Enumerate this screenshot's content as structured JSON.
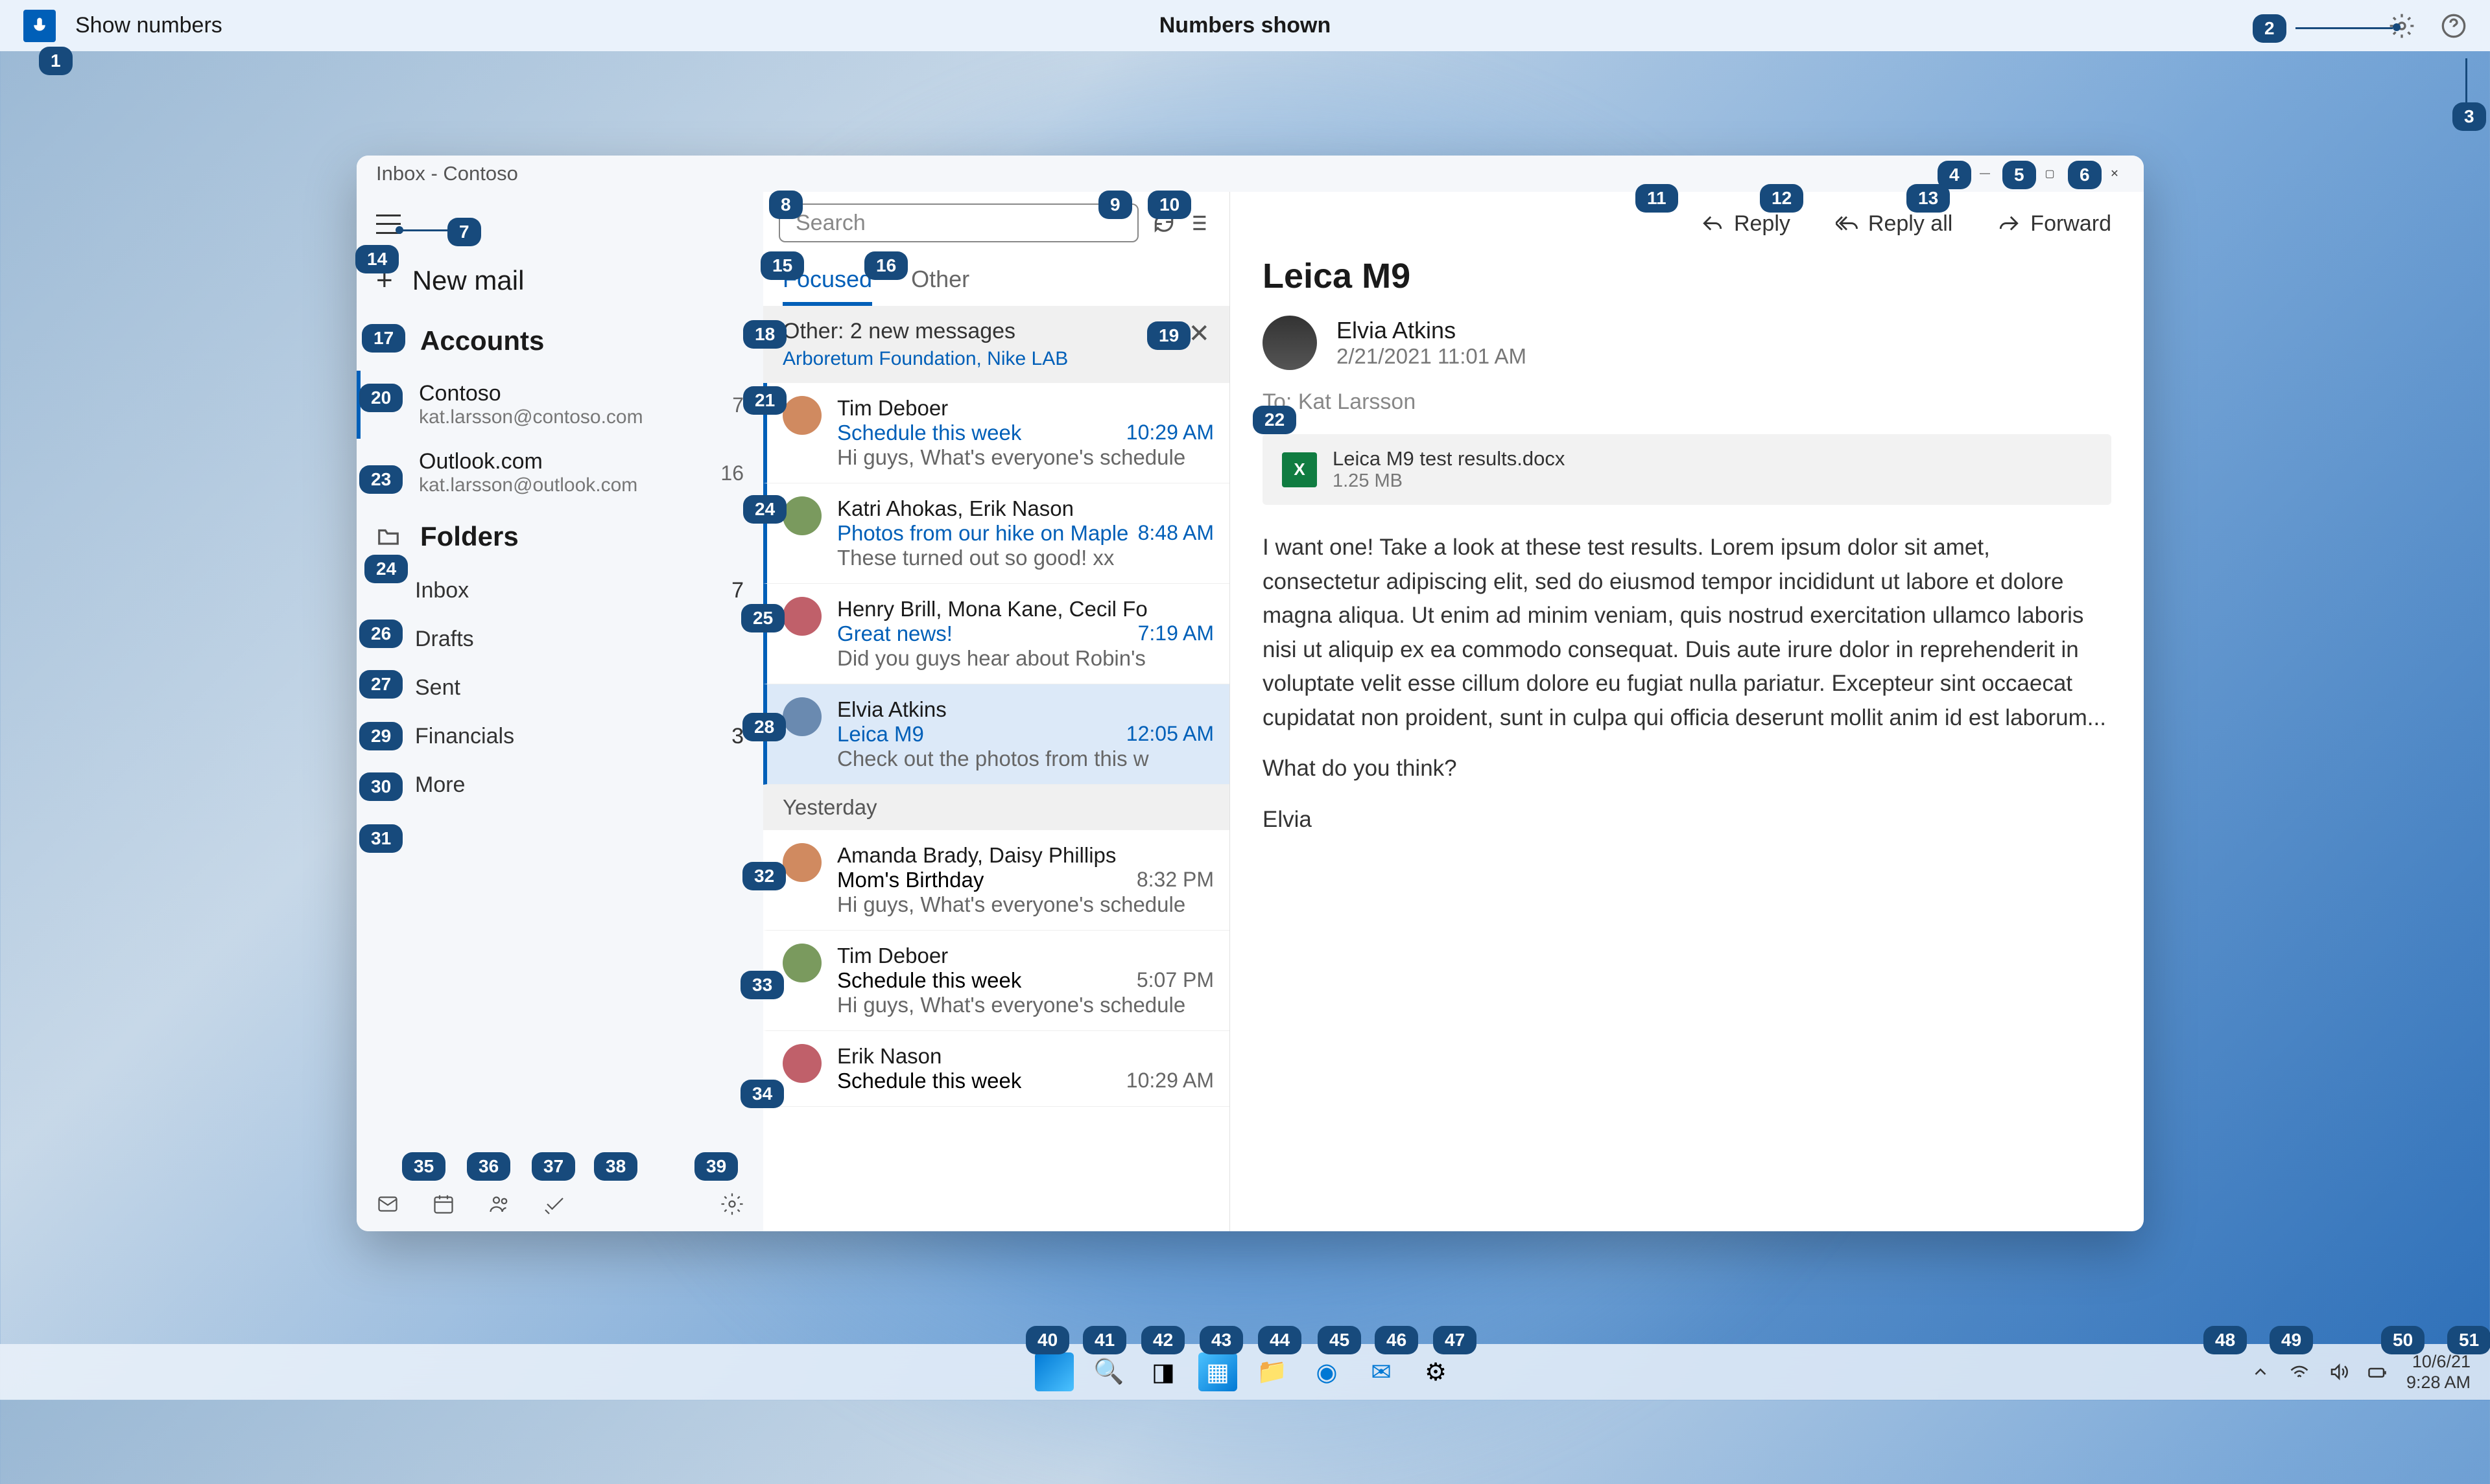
{
  "topbar": {
    "show_numbers": "Show numbers",
    "numbers_shown": "Numbers shown"
  },
  "window_title": "Inbox - Contoso",
  "nav": {
    "new_mail": "New mail",
    "accounts": "Accounts",
    "accounts_list": [
      {
        "name": "Contoso",
        "email": "kat.larsson@contoso.com",
        "count": "7"
      },
      {
        "name": "Outlook.com",
        "email": "kat.larsson@outlook.com",
        "count": "16"
      }
    ],
    "folders": "Folders",
    "folders_list": [
      {
        "name": "Inbox",
        "count": "7"
      },
      {
        "name": "Drafts",
        "count": ""
      },
      {
        "name": "Sent",
        "count": ""
      },
      {
        "name": "Financials",
        "count": "3"
      },
      {
        "name": "More",
        "count": ""
      }
    ]
  },
  "search_placeholder": "Search",
  "tabs": {
    "focused": "Focused",
    "other": "Other"
  },
  "other_banner": {
    "line1": "Other: 2 new messages",
    "line2": "Arboretum Foundation, Nike LAB"
  },
  "messages": [
    {
      "from": "Tim Deboer",
      "subject": "Schedule this week",
      "preview": "Hi guys, What's everyone's schedule",
      "time": "10:29 AM",
      "unread": true
    },
    {
      "from": "Katri Ahokas, Erik Nason",
      "subject": "Photos from our hike on Maple",
      "preview": "These turned out so good! xx",
      "time": "8:48 AM",
      "unread": true
    },
    {
      "from": "Henry Brill, Mona Kane, Cecil Fo",
      "subject": "Great news!",
      "preview": "Did you guys hear about Robin's",
      "time": "7:19 AM",
      "unread": true
    },
    {
      "from": "Elvia Atkins",
      "subject": "Leica M9",
      "preview": "Check out the photos from this w",
      "time": "12:05 AM",
      "unread": true,
      "selected": true
    }
  ],
  "date_header": "Yesterday",
  "messages2": [
    {
      "from": "Amanda Brady, Daisy Phillips",
      "subject": "Mom's Birthday",
      "preview": "Hi guys, What's everyone's schedule",
      "time": "8:32 PM"
    },
    {
      "from": "Tim Deboer",
      "subject": "Schedule this week",
      "preview": "Hi guys, What's everyone's schedule",
      "time": "5:07 PM"
    },
    {
      "from": "Erik Nason",
      "subject": "Schedule this week",
      "preview": "",
      "time": "10:29 AM"
    }
  ],
  "reader": {
    "actions": {
      "reply": "Reply",
      "reply_all": "Reply all",
      "forward": "Forward"
    },
    "title": "Leica M9",
    "sender": "Elvia Atkins",
    "date": "2/21/2021 11:01 AM",
    "to_label": "To:",
    "to": "Kat Larsson",
    "attachment": {
      "name": "Leica M9 test results.docx",
      "size": "1.25 MB"
    },
    "body1": "I want one! Take a look at these test results. Lorem ipsum dolor sit amet, consectetur adipiscing elit, sed do eiusmod tempor incididunt ut labore et dolore magna aliqua. Ut enim ad minim veniam, quis nostrud exercitation ullamco laboris nisi ut aliquip ex ea commodo consequat. Duis aute irure dolor in reprehenderit in voluptate velit esse cillum dolore eu fugiat nulla pariatur. Excepteur sint occaecat cupidatat non proident, sunt in culpa qui officia deserunt mollit anim id est laborum...",
    "body2": "What do you think?",
    "body3": "Elvia"
  },
  "taskbar": {
    "date": "10/6/21",
    "time": "9:28 AM"
  },
  "badges": [
    1,
    2,
    3,
    4,
    5,
    6,
    7,
    8,
    9,
    10,
    11,
    12,
    13,
    14,
    15,
    16,
    17,
    18,
    19,
    20,
    21,
    22,
    23,
    24,
    24,
    25,
    26,
    27,
    28,
    29,
    30,
    31,
    32,
    33,
    34,
    35,
    36,
    37,
    38,
    39,
    40,
    41,
    42,
    43,
    44,
    45,
    46,
    47,
    48,
    49,
    50,
    51
  ],
  "avatar_colors": [
    "#d08a60",
    "#7a9a5e",
    "#c0606a",
    "#6a8ab0",
    "#b07aa0",
    "#d08a60",
    "#8a8a6a"
  ]
}
